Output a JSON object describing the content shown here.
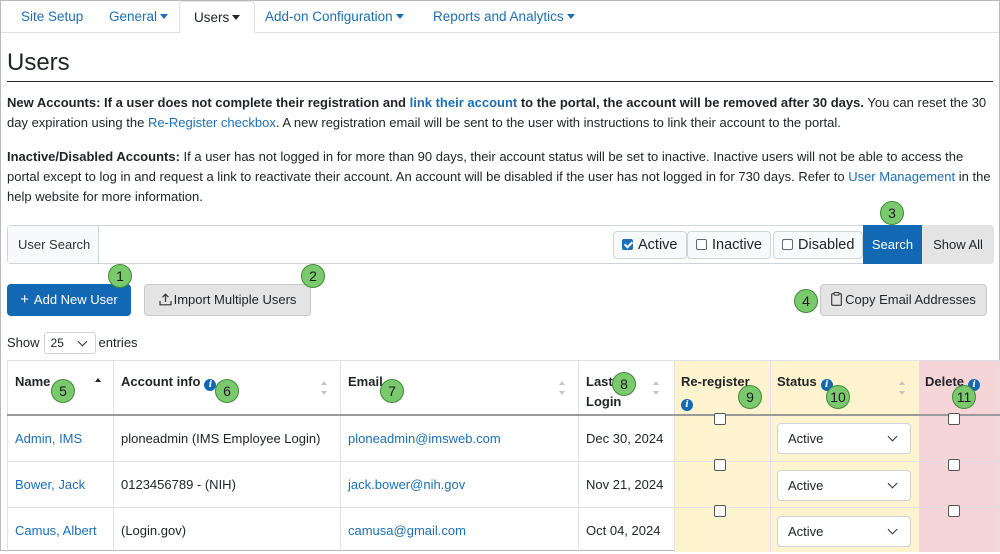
{
  "nav": {
    "tabs": [
      {
        "label": "Site Setup",
        "dropdown": false
      },
      {
        "label": "General",
        "dropdown": true
      },
      {
        "label": "Users",
        "dropdown": true,
        "active": true
      },
      {
        "label": "Add-on Configuration",
        "dropdown": true
      },
      {
        "label": "Reports and Analytics",
        "dropdown": true
      }
    ]
  },
  "page_title": "Users",
  "notice_new": {
    "bold_a": "New Accounts: If a user does not complete their registration and ",
    "link": "link their account",
    "bold_b": " to the portal, the account will be removed after 30 days.",
    "text_a": " You can reset the 30 day expiration using the ",
    "link2": "Re-Register checkbox",
    "text_b": ". A new registration email will be sent to the user with instructions to link their account to the portal."
  },
  "notice_inactive": {
    "bold": "Inactive/Disabled Accounts:",
    "text_a": " If a user has not logged in for more than 90 days, their account status will be set to inactive. Inactive users will not be able to access the portal except to log in and request a link to reactivate their account. An account will be disabled if the user has not logged in for 730 days. Refer to ",
    "link": "User Management",
    "text_b": " in the help website for more information."
  },
  "search": {
    "label": "User Search",
    "filters": [
      {
        "label": "Active",
        "checked": true
      },
      {
        "label": "Inactive",
        "checked": false
      },
      {
        "label": "Disabled",
        "checked": false
      }
    ],
    "search_button": "Search",
    "show_all_button": "Show All"
  },
  "actions": {
    "add_user": "Add New User",
    "import_users": "Import Multiple Users",
    "copy_emails": "Copy Email Addresses"
  },
  "callouts": [
    "1",
    "2",
    "3",
    "4",
    "5",
    "6",
    "7",
    "8",
    "9",
    "10",
    "11"
  ],
  "entries": {
    "show": "Show",
    "value": "25",
    "suffix": "entries"
  },
  "table": {
    "headers": {
      "name": "Name",
      "account": "Account info",
      "email": "Email",
      "last_login_1": "Last",
      "last_login_2": "Login",
      "reregister": "Re-register",
      "status": "Status",
      "delete": "Delete"
    },
    "rows": [
      {
        "name": "Admin, IMS",
        "account": "ploneadmin (IMS Employee Login)",
        "email": "ploneadmin@imsweb.com",
        "last_login": "Dec 30, 2024",
        "status": "Active"
      },
      {
        "name": "Bower, Jack",
        "account": "0123456789 - (NIH)",
        "email": "jack.bower@nih.gov",
        "last_login": "Nov 21, 2024",
        "status": "Active"
      },
      {
        "name": "Camus, Albert",
        "account": "(Login.gov)",
        "email": "camusa@gmail.com",
        "last_login": "Oct 04, 2024",
        "status": "Active"
      }
    ]
  },
  "colors": {
    "primary": "#1268b3",
    "link": "#1c6fb5",
    "reregister_bg": "#fdf3cf",
    "status_bg": "#fdf3cf",
    "delete_bg": "#f6d5d8",
    "callout": "#7bc96f"
  }
}
